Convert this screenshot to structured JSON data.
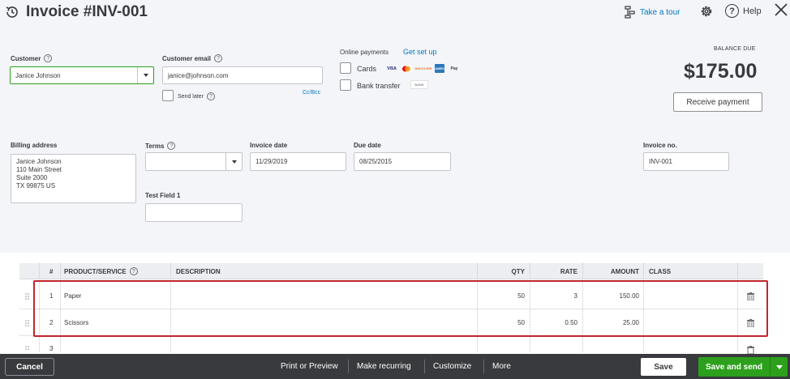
{
  "header": {
    "title": "Invoice #INV-001",
    "take_tour": "Take a tour",
    "help": "Help",
    "help_glyph": "?"
  },
  "customer": {
    "label": "Customer",
    "value": "Janice Johnson"
  },
  "customer_email": {
    "label": "Customer email",
    "value": "janice@johnson.com",
    "send_later": "Send later",
    "cc_bcc": "Cc/Bcc"
  },
  "online_payments": {
    "label": "Online payments",
    "get_set_up": "Get set up",
    "cards": "Cards",
    "bank_transfer": "Bank transfer",
    "card_logos": [
      "VISA",
      "MC",
      "DISCOVER",
      "AMEX",
      "Pay"
    ],
    "bank_logo": "BANK"
  },
  "balance": {
    "label": "BALANCE DUE",
    "amount": "$175.00",
    "receive_payment": "Receive payment"
  },
  "billing": {
    "label": "Billing address",
    "lines": [
      "Janice Johnson",
      "110 Main Street",
      "Suite 2000",
      "TX  99875 US"
    ]
  },
  "terms": {
    "label": "Terms",
    "value": ""
  },
  "invoice_date": {
    "label": "Invoice date",
    "value": "11/29/2019"
  },
  "due_date": {
    "label": "Due date",
    "value": "08/25/2015"
  },
  "test_field": {
    "label": "Test Field 1",
    "value": ""
  },
  "invoice_no": {
    "label": "Invoice no.",
    "value": "INV-001"
  },
  "table": {
    "headers": {
      "num": "#",
      "product": "PRODUCT/SERVICE",
      "description": "DESCRIPTION",
      "qty": "QTY",
      "rate": "RATE",
      "amount": "AMOUNT",
      "class": "CLASS"
    },
    "rows": [
      {
        "num": "1",
        "product": "Paper",
        "description": "",
        "qty": "50",
        "rate": "3",
        "amount": "150.00",
        "class": ""
      },
      {
        "num": "2",
        "product": "Scissors",
        "description": "",
        "qty": "50",
        "rate": "0.50",
        "amount": "25.00",
        "class": ""
      },
      {
        "num": "3",
        "product": "",
        "description": "",
        "qty": "",
        "rate": "",
        "amount": "",
        "class": ""
      }
    ]
  },
  "footer": {
    "cancel": "Cancel",
    "print_preview": "Print or Preview",
    "make_recurring": "Make recurring",
    "customize": "Customize",
    "more": "More",
    "save": "Save",
    "save_and_send": "Save and send"
  },
  "colors": {
    "accent_green": "#2ca01c",
    "link_blue": "#0077c5",
    "footer_bg": "#393a3d",
    "highlight_red": "#c0262c"
  }
}
